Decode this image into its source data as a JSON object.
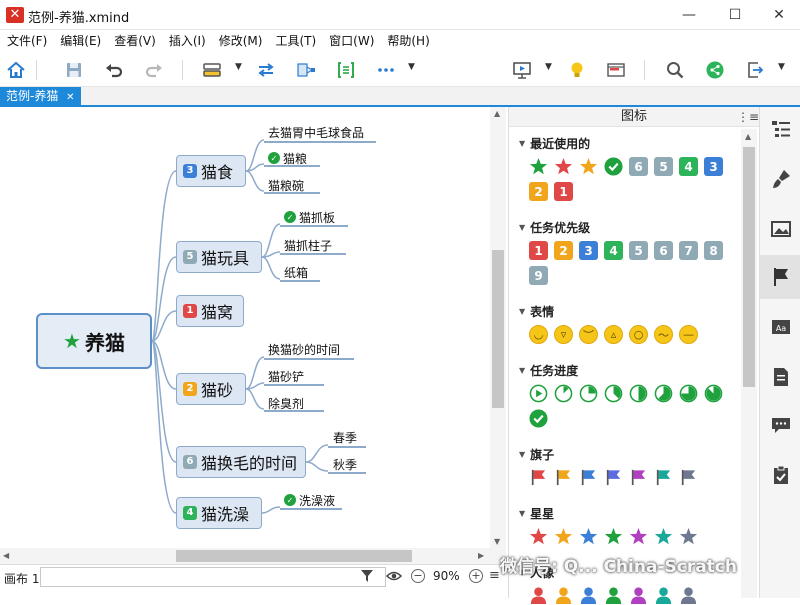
{
  "window": {
    "title": "范例-养猫.xmind",
    "minimize": "—",
    "maximize": "☐",
    "close": "✕"
  },
  "menu": [
    "文件(F)",
    "编辑(E)",
    "查看(V)",
    "插入(I)",
    "修改(M)",
    "工具(T)",
    "窗口(W)",
    "帮助(H)"
  ],
  "tab": {
    "label": "范例-养猫",
    "close": "✕"
  },
  "mindmap": {
    "central": {
      "label": "养猫",
      "icon": "star-icon",
      "icon_color": "#1fa23d"
    },
    "topics": [
      {
        "label": "猫食",
        "badge": "3",
        "badge_color": "#3c7fd6",
        "subs": [
          {
            "label": "去猫胃中毛球食品"
          },
          {
            "label": "猫粮",
            "icon": "check-icon"
          },
          {
            "label": "猫粮碗"
          }
        ]
      },
      {
        "label": "猫玩具",
        "badge": "5",
        "badge_color": "#8faab5",
        "subs": [
          {
            "label": "猫抓板",
            "icon": "check-icon"
          },
          {
            "label": "猫抓柱子"
          },
          {
            "label": "纸箱"
          }
        ]
      },
      {
        "label": "猫窝",
        "badge": "1",
        "badge_color": "#e04848",
        "subs": []
      },
      {
        "label": "猫砂",
        "badge": "2",
        "badge_color": "#f1a51b",
        "subs": [
          {
            "label": "换猫砂的时间"
          },
          {
            "label": "猫砂铲"
          },
          {
            "label": "除臭剂"
          }
        ]
      },
      {
        "label": "猫换毛的时间",
        "badge": "6",
        "badge_color": "#8faab5",
        "subs": [
          {
            "label": "春季"
          },
          {
            "label": "秋季"
          }
        ]
      },
      {
        "label": "猫洗澡",
        "badge": "4",
        "badge_color": "#2db35a",
        "subs": [
          {
            "label": "洗澡液",
            "icon": "check-icon"
          }
        ]
      }
    ]
  },
  "statusbar": {
    "canvas_label": "画布 1",
    "zoom": "90%"
  },
  "panel": {
    "title": "图标",
    "sections": [
      {
        "title": "最近使用的",
        "items": [
          {
            "type": "star",
            "color": "#1fa23d"
          },
          {
            "type": "star",
            "color": "#e04848"
          },
          {
            "type": "star",
            "color": "#f1a51b"
          },
          {
            "type": "check",
            "color": "#1fa23d"
          },
          {
            "type": "num",
            "text": "6",
            "color": "#8faab5"
          },
          {
            "type": "num",
            "text": "5",
            "color": "#8faab5"
          },
          {
            "type": "num",
            "text": "4",
            "color": "#2db35a"
          },
          {
            "type": "num",
            "text": "3",
            "color": "#3c7fd6"
          },
          {
            "type": "num",
            "text": "2",
            "color": "#f1a51b"
          },
          {
            "type": "num",
            "text": "1",
            "color": "#e04848"
          }
        ]
      },
      {
        "title": "任务优先级",
        "items": [
          {
            "type": "num",
            "text": "1",
            "color": "#e04848"
          },
          {
            "type": "num",
            "text": "2",
            "color": "#f1a51b"
          },
          {
            "type": "num",
            "text": "3",
            "color": "#3c7fd6"
          },
          {
            "type": "num",
            "text": "4",
            "color": "#2db35a"
          },
          {
            "type": "num",
            "text": "5",
            "color": "#8faab5"
          },
          {
            "type": "num",
            "text": "6",
            "color": "#8faab5"
          },
          {
            "type": "num",
            "text": "7",
            "color": "#8faab5"
          },
          {
            "type": "num",
            "text": "8",
            "color": "#8faab5"
          },
          {
            "type": "num",
            "text": "9",
            "color": "#8faab5"
          }
        ]
      },
      {
        "title": "表情",
        "items": [
          {
            "type": "emoji",
            "name": "smile-icon",
            "glyph": "◡"
          },
          {
            "type": "emoji",
            "name": "laugh-icon",
            "glyph": "▿"
          },
          {
            "type": "emoji",
            "name": "angry-icon",
            "glyph": "︶"
          },
          {
            "type": "emoji",
            "name": "cry-icon",
            "glyph": "▵"
          },
          {
            "type": "emoji",
            "name": "surprise-icon",
            "glyph": "○"
          },
          {
            "type": "emoji",
            "name": "sleepy-icon",
            "glyph": "～"
          },
          {
            "type": "emoji",
            "name": "neutral-icon",
            "glyph": "—"
          }
        ]
      },
      {
        "title": "任务进度",
        "items": [
          {
            "type": "progress",
            "value": 0
          },
          {
            "type": "progress",
            "value": 0.125
          },
          {
            "type": "progress",
            "value": 0.25
          },
          {
            "type": "progress",
            "value": 0.375
          },
          {
            "type": "progress",
            "value": 0.5
          },
          {
            "type": "progress",
            "value": 0.625
          },
          {
            "type": "progress",
            "value": 0.75
          },
          {
            "type": "progress",
            "value": 0.875
          },
          {
            "type": "check",
            "color": "#1fa23d"
          }
        ]
      },
      {
        "title": "旗子",
        "items": [
          {
            "type": "flag",
            "color": "#e04848"
          },
          {
            "type": "flag",
            "color": "#f1a51b"
          },
          {
            "type": "flag",
            "color": "#3c7fd6"
          },
          {
            "type": "flag",
            "color": "#5b6be0"
          },
          {
            "type": "flag",
            "color": "#b040c0"
          },
          {
            "type": "flag",
            "color": "#1aa89a"
          },
          {
            "type": "flag",
            "color": "#6e7890"
          }
        ]
      },
      {
        "title": "星星",
        "items": [
          {
            "type": "star",
            "color": "#e04848"
          },
          {
            "type": "star",
            "color": "#f1a51b"
          },
          {
            "type": "star",
            "color": "#3c7fd6"
          },
          {
            "type": "star",
            "color": "#1fa23d"
          },
          {
            "type": "star",
            "color": "#b040c0"
          },
          {
            "type": "star",
            "color": "#1aa89a"
          },
          {
            "type": "star",
            "color": "#6e7890"
          }
        ]
      },
      {
        "title": "人像",
        "items": [
          {
            "type": "person",
            "color": "#e04848"
          },
          {
            "type": "person",
            "color": "#f1a51b"
          },
          {
            "type": "person",
            "color": "#3c7fd6"
          },
          {
            "type": "person",
            "color": "#1fa23d"
          },
          {
            "type": "person",
            "color": "#b040c0"
          },
          {
            "type": "person",
            "color": "#1aa89a"
          },
          {
            "type": "person",
            "color": "#6e7890"
          }
        ]
      }
    ]
  },
  "watermark": "微信号: Q... China-Scratch"
}
